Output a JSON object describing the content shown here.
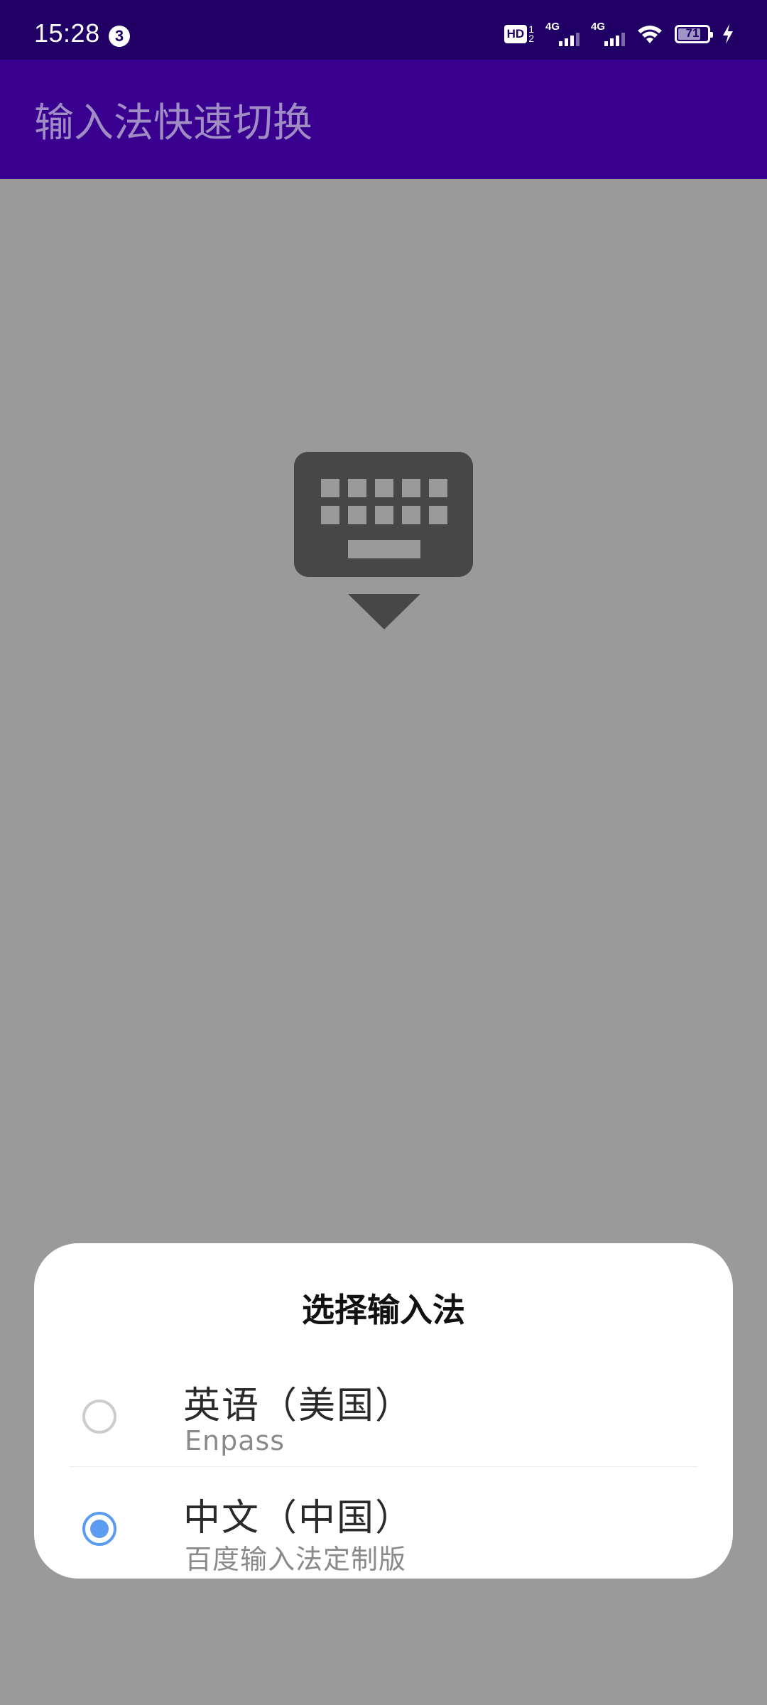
{
  "status_bar": {
    "time": "15:28",
    "notification_count": "3",
    "hd_label": "HD",
    "hd_sub_top": "1",
    "hd_sub_bottom": "2",
    "network1_label": "4G",
    "network2_label": "4G",
    "battery_level": "71",
    "charging": true
  },
  "app_bar": {
    "title": "输入法快速切换"
  },
  "dialog": {
    "title": "选择输入法",
    "options": [
      {
        "label": "英语（美国）",
        "subtitle": "Enpass",
        "selected": false
      },
      {
        "label": "中文（中国）",
        "subtitle": "百度输入法定制版",
        "selected": true
      }
    ]
  },
  "colors": {
    "status_bar_bg": "#210066",
    "app_bar_bg": "#390090",
    "title_text": "#9f8dc4",
    "scrim_bg": "#9a9a9a",
    "radio_accent": "#5b9cf0",
    "keyboard_icon": "#474747"
  },
  "icons": {
    "center_icon": "keyboard-hide-icon",
    "wifi": "wifi-icon",
    "charging": "lightning-bolt-icon"
  }
}
